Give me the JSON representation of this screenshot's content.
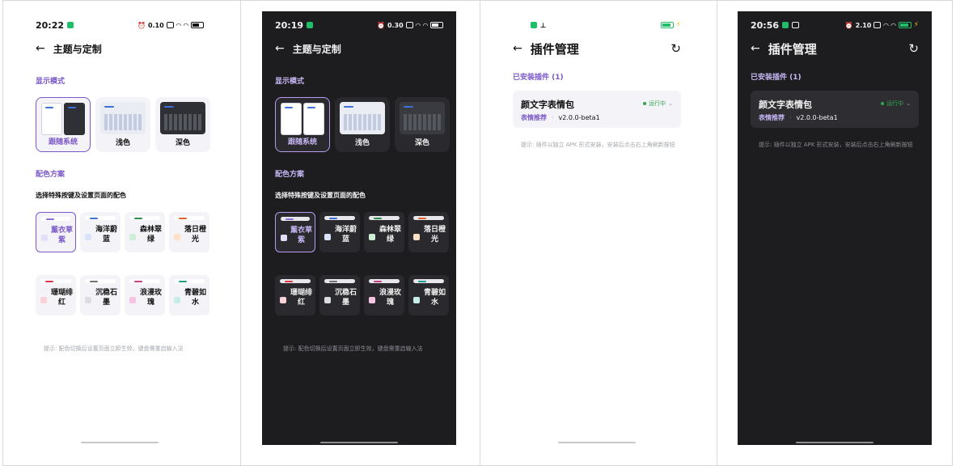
{
  "screens": [
    {
      "status_time": "20:22",
      "status_net": "0.10",
      "title": "主题与定制",
      "display_mode_heading": "显示模式",
      "modes": [
        {
          "label": "跟随系统"
        },
        {
          "label": "浅色"
        },
        {
          "label": "深色"
        }
      ],
      "color_heading": "配色方案",
      "color_desc": "选择特殊按键及设置页面的配色",
      "colors": [
        {
          "label": "薰衣草紫",
          "accent": "#8a6fd6",
          "chip": "#e4defa"
        },
        {
          "label": "海洋蔚蓝",
          "accent": "#3f6fd8",
          "chip": "#d9e4fb"
        },
        {
          "label": "森林翠绿",
          "accent": "#2e8d4a",
          "chip": "#cfeed6"
        },
        {
          "label": "落日橙光",
          "accent": "#e0622a",
          "chip": "#fde1c7"
        },
        {
          "label": "珊瑚绯红",
          "accent": "#d83a4b",
          "chip": "#fbd2d7"
        },
        {
          "label": "沉稳石墨",
          "accent": "#6f7378",
          "chip": "#dcdde0"
        },
        {
          "label": "浪漫玫瑰",
          "accent": "#c43d86",
          "chip": "#f7c5e1"
        },
        {
          "label": "青碧如水",
          "accent": "#1c9b8a",
          "chip": "#c6eee8"
        }
      ],
      "tip": "提示: 配色切换后设置页面立即生效，键盘需重启输入法"
    },
    {
      "status_time": "20:19",
      "status_net": "0.30",
      "title": "主题与定制",
      "display_mode_heading": "显示模式",
      "modes": [
        {
          "label": "跟随系统"
        },
        {
          "label": "浅色"
        },
        {
          "label": "深色"
        }
      ],
      "color_heading": "配色方案",
      "color_desc": "选择特殊按键及设置页面的配色",
      "colors": [
        {
          "label": "薰衣草紫",
          "accent": "#8a6fd6",
          "chip": "#e4defa"
        },
        {
          "label": "海洋蔚蓝",
          "accent": "#3f6fd8",
          "chip": "#d9e4fb"
        },
        {
          "label": "森林翠绿",
          "accent": "#2e8d4a",
          "chip": "#cfeed6"
        },
        {
          "label": "落日橙光",
          "accent": "#e0622a",
          "chip": "#fde1c7"
        },
        {
          "label": "珊瑚绯红",
          "accent": "#d83a4b",
          "chip": "#fbd2d7"
        },
        {
          "label": "沉稳石墨",
          "accent": "#6f7378",
          "chip": "#dcdde0"
        },
        {
          "label": "浪漫玫瑰",
          "accent": "#c43d86",
          "chip": "#f7c5e1"
        },
        {
          "label": "青碧如水",
          "accent": "#1c9b8a",
          "chip": "#c6eee8"
        }
      ],
      "tip": "提示: 配色切换后设置页面立即生效，键盘需重启输入法"
    },
    {
      "title": "插件管理",
      "installed_heading": "已安装插件 (1)",
      "plugin_name": "颜文字表情包",
      "plugin_tag": "表情推荐",
      "plugin_sep": "·",
      "plugin_version": "v2.0.0-beta1",
      "plugin_status": "运行中",
      "tip": "提示: 插件以独立 APK 形式安装，安装后点击右上角刷新按钮"
    },
    {
      "status_time": "20:56",
      "status_net": "2.10",
      "title": "插件管理",
      "installed_heading": "已安装插件 (1)",
      "plugin_name": "颜文字表情包",
      "plugin_tag": "表情推荐",
      "plugin_sep": "·",
      "plugin_version": "v2.0.0-beta1",
      "plugin_status": "运行中",
      "tip": "提示: 插件以独立 APK 形式安装，安装后点击右上角刷新按钮"
    }
  ],
  "icons": {
    "back": "←",
    "refresh": "↻",
    "chevron": "⌄"
  }
}
